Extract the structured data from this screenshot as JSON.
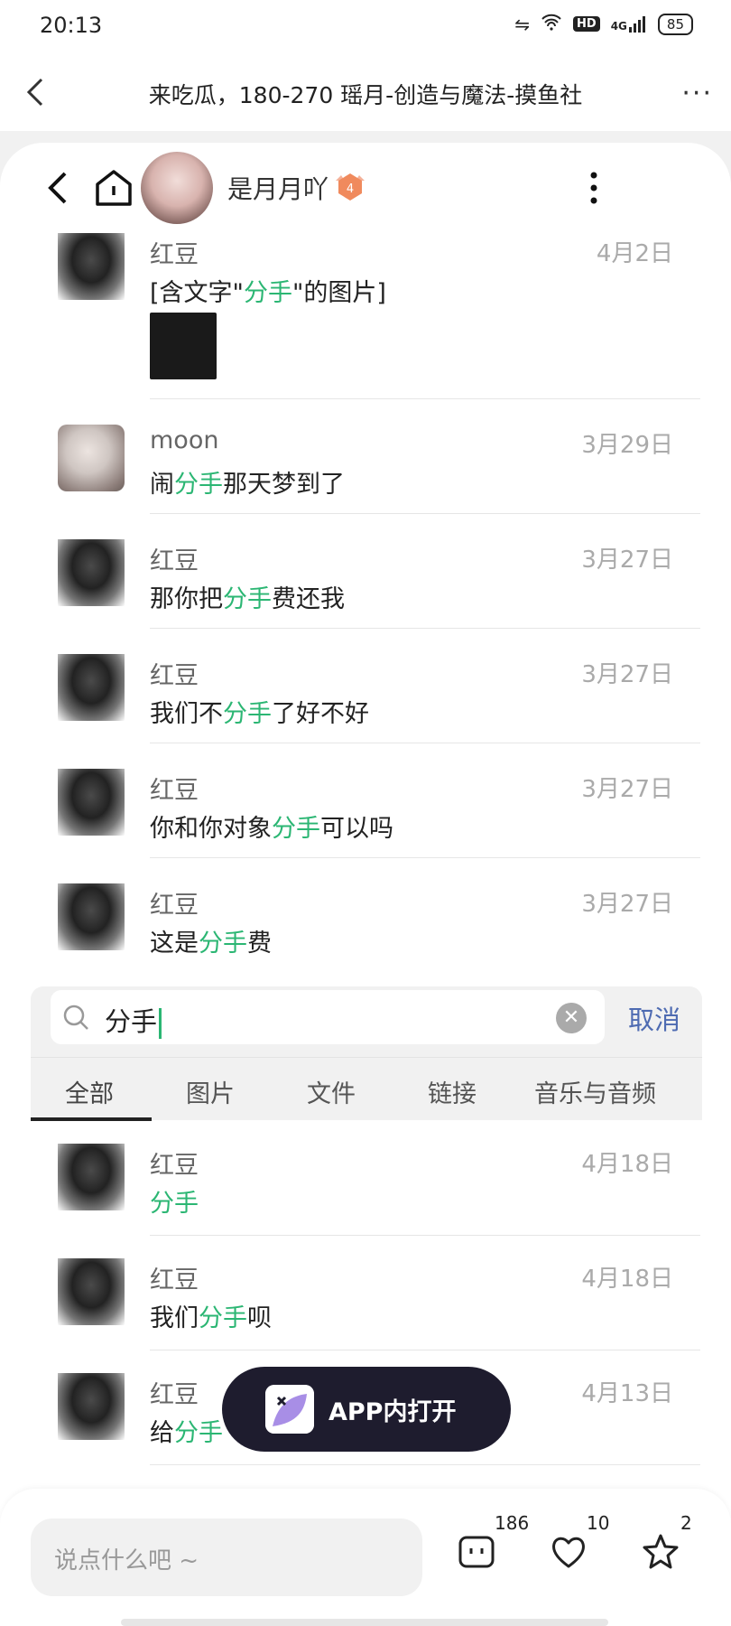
{
  "status_bar": {
    "time": "20:13",
    "network": "4G",
    "hd": "HD",
    "battery": "85"
  },
  "top_nav": {
    "title": "来吃瓜，180-270 瑶月-创造与魔法-摸鱼社"
  },
  "chat_header": {
    "name": "是月月吖",
    "level": "4"
  },
  "messages": [
    {
      "sender": "红豆",
      "date": "4月2日",
      "pre": "[含文字\"",
      "hl": "分手",
      "post": "\"的图片]",
      "avatar": "hair",
      "has_image": true
    },
    {
      "sender": "moon",
      "date": "3月29日",
      "pre": "闹",
      "hl": "分手",
      "post": "那天梦到了",
      "avatar": "girl"
    },
    {
      "sender": "红豆",
      "date": "3月27日",
      "pre": "那你把",
      "hl": "分手",
      "post": "费还我",
      "avatar": "hair"
    },
    {
      "sender": "红豆",
      "date": "3月27日",
      "pre": "我们不",
      "hl": "分手",
      "post": "了好不好",
      "avatar": "hair"
    },
    {
      "sender": "红豆",
      "date": "3月27日",
      "pre": "你和你对象",
      "hl": "分手",
      "post": "可以吗",
      "avatar": "hair"
    },
    {
      "sender": "红豆",
      "date": "3月27日",
      "pre": "这是",
      "hl": "分手",
      "post": "费",
      "avatar": "hair"
    }
  ],
  "search": {
    "query": "分手",
    "cancel_label": "取消"
  },
  "tabs": [
    "全部",
    "图片",
    "文件",
    "链接",
    "音乐与音频"
  ],
  "results": [
    {
      "sender": "红豆",
      "date": "4月18日",
      "pre": "",
      "hl": "分手",
      "post": "",
      "avatar": "hair"
    },
    {
      "sender": "红豆",
      "date": "4月18日",
      "pre": "我们",
      "hl": "分手",
      "post": "呗",
      "avatar": "hair"
    },
    {
      "sender": "红豆",
      "date": "4月13日",
      "pre": "给",
      "hl": "分手",
      "post": "",
      "avatar": "hair"
    }
  ],
  "app_button": {
    "label": "APP内打开"
  },
  "bottom_bar": {
    "placeholder": "说点什么吧 ~",
    "comment_count": "186",
    "like_count": "10",
    "star_count": "2"
  },
  "colors": {
    "highlight": "#2bb673",
    "cancel": "#4e6bb2",
    "app_button_bg": "#1e1c2e",
    "level_badge": "#f08a5d"
  }
}
